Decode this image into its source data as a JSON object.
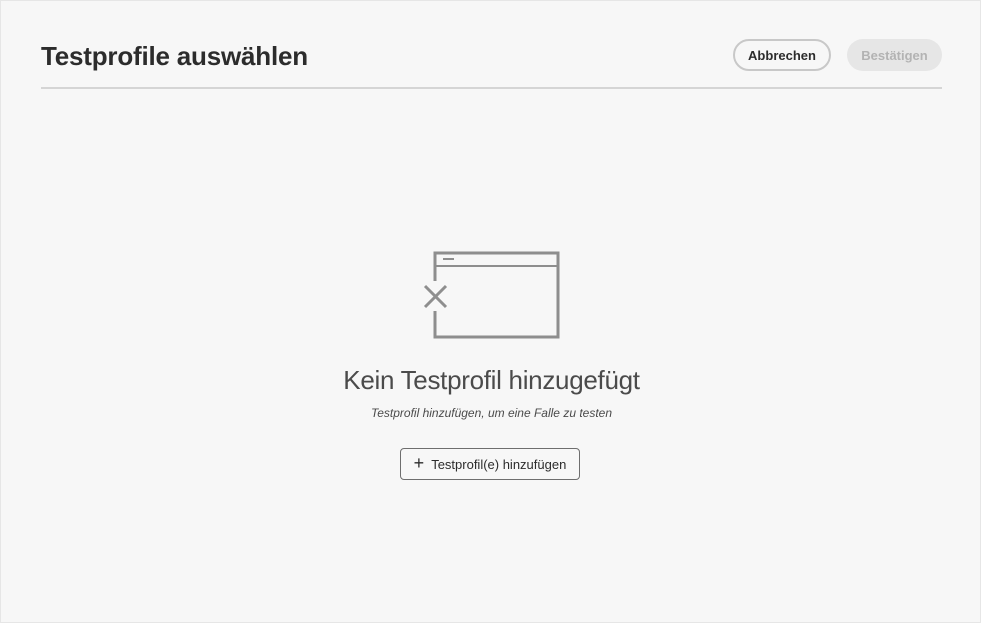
{
  "dialog": {
    "title": "Testprofile auswählen",
    "cancel_label": "Abbrechen",
    "confirm_label": "Bestätigen"
  },
  "empty_state": {
    "illustration_icon": "window-error-icon",
    "title": "Kein Testprofil hinzugefügt",
    "subtitle": "Testprofil hinzufügen, um eine Falle zu testen",
    "add_button_icon": "plus-icon",
    "add_button_label": "Testprofil(e) hinzufügen"
  },
  "colors": {
    "background": "#f7f7f7",
    "text": "#2c2c2c",
    "illustration": "#8e8e8e",
    "disabled_button_bg": "#e6e6e6",
    "disabled_button_text": "#b3b3b3"
  }
}
